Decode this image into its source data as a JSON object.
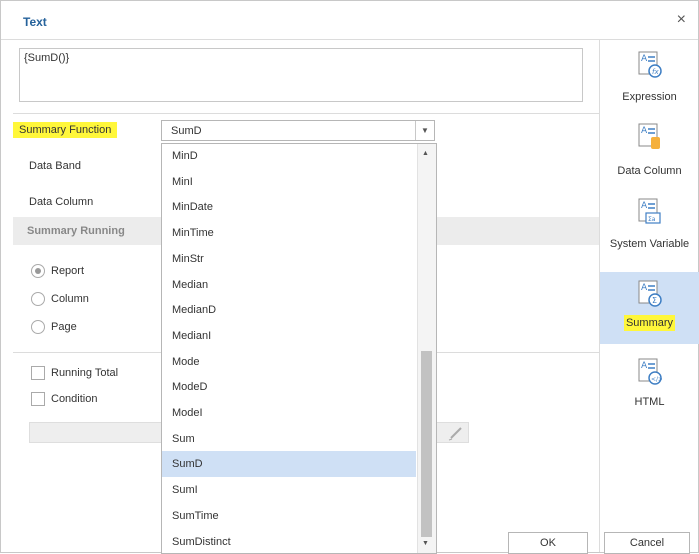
{
  "dialog": {
    "title": "Text",
    "close_glyph": "×"
  },
  "expression": {
    "value": "{SumD()}"
  },
  "form": {
    "summary_function_label": "Summary Function",
    "summary_function_value": "SumD",
    "data_band_label": "Data Band",
    "data_column_label": "Data Column",
    "summary_running_label": "Summary Running",
    "running_options": [
      "Report",
      "Column",
      "Page"
    ],
    "running_selected": "Report",
    "running_total_label": "Running Total",
    "condition_label": "Condition"
  },
  "dropdown": {
    "items": [
      "MinD",
      "MinI",
      "MinDate",
      "MinTime",
      "MinStr",
      "Median",
      "MedianD",
      "MedianI",
      "Mode",
      "ModeD",
      "ModeI",
      "Sum",
      "SumD",
      "SumI",
      "SumTime",
      "SumDistinct"
    ],
    "selected": "SumD"
  },
  "sidebar": {
    "items": [
      {
        "label": "Expression",
        "icon": "expression-icon"
      },
      {
        "label": "Data Column",
        "icon": "data-column-icon"
      },
      {
        "label": "System Variable",
        "icon": "system-variable-icon"
      },
      {
        "label": "Summary",
        "icon": "summary-icon",
        "active": true
      },
      {
        "label": "HTML",
        "icon": "html-icon"
      }
    ]
  },
  "buttons": {
    "ok": "OK",
    "cancel": "Cancel"
  },
  "colors": {
    "title": "#25629b",
    "highlight": "#fff73a",
    "selection": "#cfe0f5",
    "icon_blue": "#3f7fc4",
    "icon_orange": "#f5b03c"
  }
}
